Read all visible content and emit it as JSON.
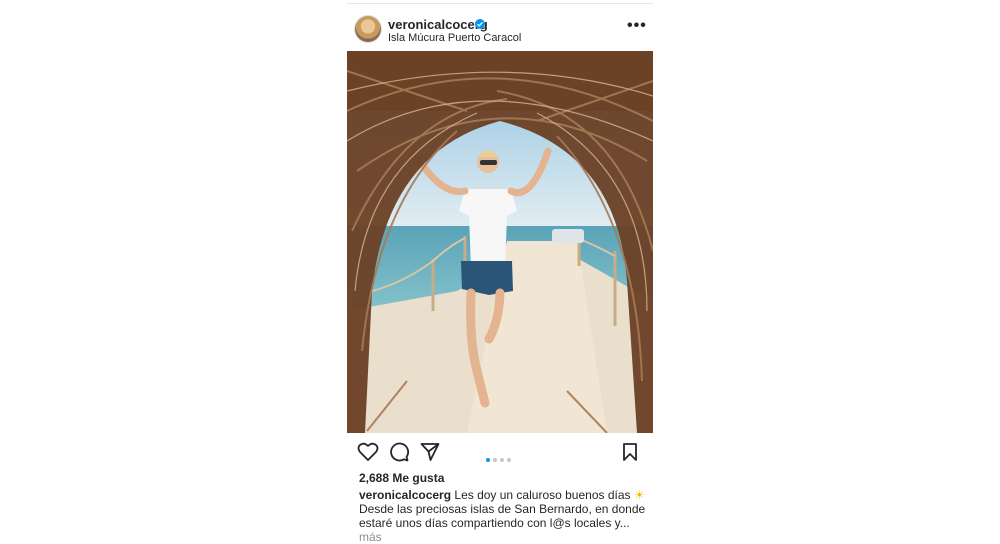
{
  "post": {
    "username": "veronicalcocerg",
    "location": "Isla Múcura Puerto Caracol",
    "likes": "2,688 Me gusta",
    "caption": {
      "username": "veronicalcocerg",
      "line1": "Les doy un caluroso buenos días",
      "emoji": "☀",
      "line2": "Desde las preciosas islas de San Bernardo, en donde",
      "line3": "estaré unos días compartiendo con l@s locales y...",
      "more": "más"
    },
    "carousel": {
      "count": 4,
      "active": 1
    }
  },
  "icons": [
    "more-options-icon",
    "verified-badge-icon",
    "heart-icon",
    "comment-icon",
    "share-icon",
    "bookmark-icon"
  ],
  "colors": {
    "accent": "#0095f6",
    "text": "#262626",
    "muted": "#8e8e8e"
  }
}
